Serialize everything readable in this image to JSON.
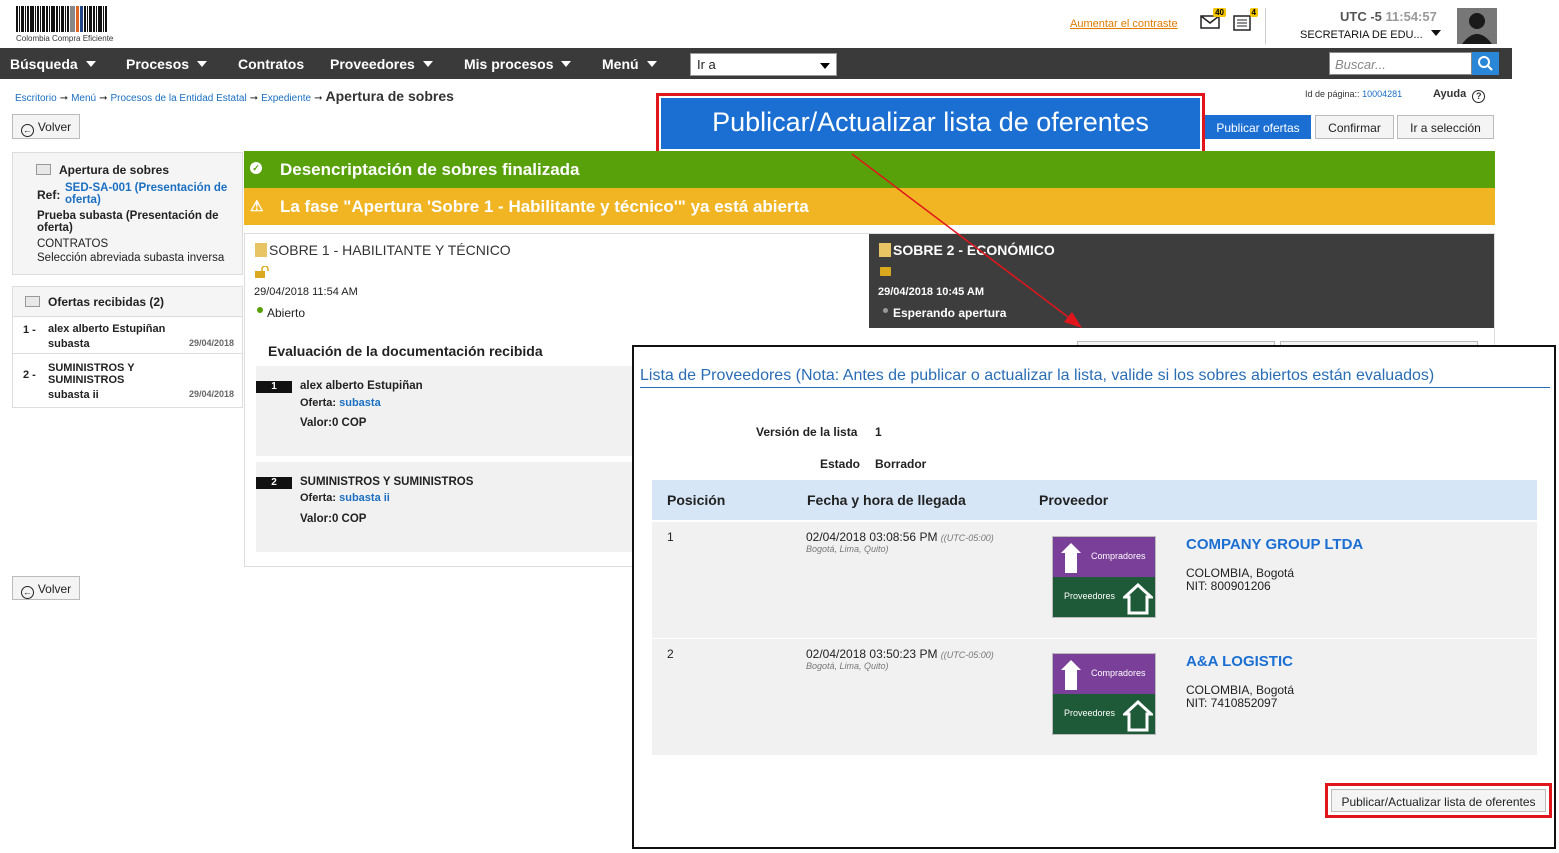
{
  "header": {
    "logo_text": "Colombia Compra Eficiente",
    "contrast_link": "Aumentar el contraste",
    "mail_count": "40",
    "notif_count": "4",
    "utc_label": "UTC -5",
    "utc_time": "11:54:57",
    "entity": "SECRETARIA DE EDU..."
  },
  "nav": {
    "items": [
      "Búsqueda",
      "Procesos",
      "Contratos",
      "Proveedores",
      "Mis procesos",
      "Menú"
    ],
    "goto_value": "Ir a",
    "search_placeholder": "Buscar..."
  },
  "breadcrumb": {
    "items": [
      "Escritorio",
      "Menú",
      "Procesos de la Entidad Estatal",
      "Expediente"
    ],
    "current": "Apertura de sobres"
  },
  "page_id": {
    "label": "Id de página::",
    "value": "10004281"
  },
  "help_label": "Ayuda",
  "buttons": {
    "back": "Volver",
    "publish_big": "Publicar/Actualizar lista de oferentes",
    "publish_offers": "Publicar ofertas",
    "confirm": "Confirmar",
    "goto_selection": "Ir a selección"
  },
  "summary": {
    "title": "Apertura de sobres",
    "ref_label": "Ref:",
    "ref_value": "SED-SA-001 (Presentación de oferta)",
    "process_name": "Prueba subasta (Presentación de oferta)",
    "category": "CONTRATOS",
    "modality": "Selección abreviada subasta inversa"
  },
  "offers": {
    "title": "Ofertas recibidas (2)",
    "items": [
      {
        "num": "1 -",
        "name": "alex alberto Estupiñan",
        "sub": "subasta",
        "date": "29/04/2018"
      },
      {
        "num": "2 -",
        "name": "SUMINISTROS Y SUMINISTROS",
        "sub": "subasta ii",
        "date": "29/04/2018"
      }
    ]
  },
  "banners": {
    "green": "Desencriptación de sobres finalizada",
    "yellow": "La fase \"Apertura 'Sobre 1 - Habilitante y técnico'\" ya está abierta"
  },
  "sobre1": {
    "title": "SOBRE 1 - HABILITANTE Y TÉCNICO",
    "date": "29/04/2018 11:54 AM",
    "status": "Abierto"
  },
  "sobre2": {
    "title": "SOBRE 2 - ECONÓMICO",
    "date": "29/04/2018 10:45 AM",
    "status": "Esperando apertura"
  },
  "evaluation": {
    "title": "Evaluación de la documentación recibida",
    "offer_label": "Oferta:",
    "items": [
      {
        "num": "1",
        "name": "alex alberto Estupiñan",
        "offer": "subasta",
        "value": "Valor:0 COP"
      },
      {
        "num": "2",
        "name": "SUMINISTROS Y SUMINISTROS",
        "offer": "subasta ii",
        "value": "Valor:0 COP"
      }
    ]
  },
  "modal": {
    "title": "Lista de Proveedores (Nota: Antes de publicar o actualizar la lista, valide si los sobres abiertos están evaluados)",
    "version_label": "Versión de la lista",
    "version_value": "1",
    "state_label": "Estado",
    "state_value": "Borrador",
    "columns": [
      "Posición",
      "Fecha y hora de llegada",
      "Proveedor"
    ],
    "logo_top": "Compradores",
    "logo_bottom": "Proveedores",
    "rows": [
      {
        "position": "1",
        "datetime": "02/04/2018 03:08:56 PM",
        "tz": "((UTC-05:00)",
        "tz2": "Bogotá, Lima, Quito)",
        "vendor": "COMPANY GROUP LTDA",
        "location": "COLOMBIA, Bogotá",
        "nit": "NIT: 800901206"
      },
      {
        "position": "2",
        "datetime": "02/04/2018 03:50:23 PM",
        "tz": "((UTC-05:00)",
        "tz2": "Bogotá, Lima, Quito)",
        "vendor": "A&A LOGISTIC",
        "location": "COLOMBIA, Bogotá",
        "nit": "NIT: 7410852097"
      }
    ],
    "publish_button": "Publicar/Actualizar lista de oferentes"
  },
  "colors": {
    "nav_bg": "#3a3a3a",
    "green_banner": "#59a10b",
    "yellow_banner": "#f1b524",
    "primary_blue": "#1b6fd3",
    "highlight_red": "#e0161c"
  }
}
